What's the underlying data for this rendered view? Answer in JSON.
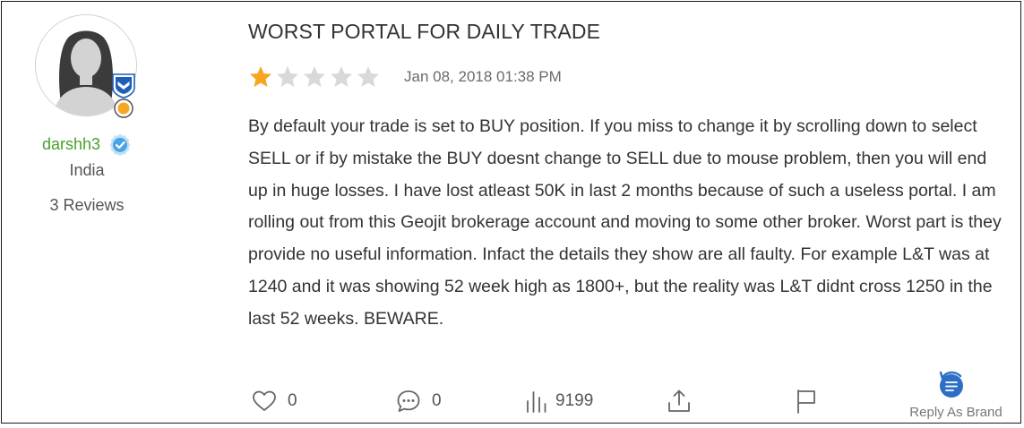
{
  "user": {
    "username": "darshh3",
    "location": "India",
    "reviews_count": "3 Reviews",
    "avatar_icon": "female-silhouette-avatar-icon",
    "verified_icon": "verified-check-icon",
    "level_badge_icon": "shield-chevron-badge-icon",
    "medal_icon": "orange-medal-icon"
  },
  "review": {
    "title": "WORST PORTAL FOR DAILY TRADE",
    "rating": 1,
    "max_rating": 5,
    "date": "Jan 08, 2018 01:38 PM",
    "body": "By default your trade is set to BUY position. If you miss to change it by scrolling down to select SELL or if by mistake the BUY doesnt change to SELL due to mouse problem, then you will end up in huge losses. I have lost atleast 50K in last 2 months because of such a useless portal. I am rolling out from this Geojit brokerage account and moving to some other broker. Worst part is they provide no useful information. Infact the details they show are all faulty. For example L&T was at 1240 and it was showing 52 week high as 1800+, but the reality was L&T didnt cross 1250 in the last 52 weeks. BEWARE."
  },
  "actions": {
    "likes": "0",
    "comments": "0",
    "views": "9199",
    "reply_as_brand": "Reply As Brand"
  },
  "colors": {
    "username": "#4aa02c",
    "star_filled": "#f5a623",
    "star_empty": "#d9d9d9",
    "verified": "#4aa3e6",
    "badge_blue": "#1e5fb8",
    "medal_orange": "#f5a623"
  }
}
